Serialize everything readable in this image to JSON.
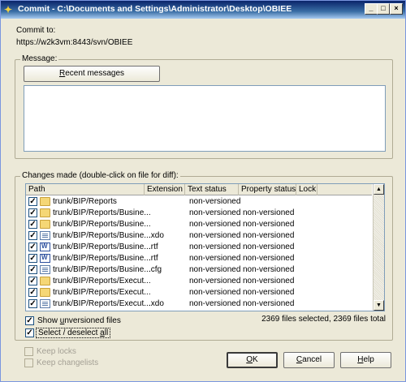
{
  "window": {
    "title": "Commit - C:\\Documents and Settings\\Administrator\\Desktop\\OBIEE",
    "minimize": "_",
    "maximize": "□",
    "close": "×"
  },
  "commit": {
    "label": "Commit to:",
    "url": "https://w2k3vm:8443/svn/OBIEE"
  },
  "message": {
    "group_label": "Message:",
    "recent_button": "Recent messages",
    "value": ""
  },
  "changes": {
    "group_label": "Changes made (double-click on file for diff):",
    "columns": [
      "Path",
      "Extension",
      "Text status",
      "Property status",
      "Lock"
    ],
    "rows": [
      {
        "checked": "✓",
        "icon": "folder",
        "path": "trunk/BIP/Reports",
        "ext": "",
        "text_status": "non-versioned",
        "prop_status": ""
      },
      {
        "checked": "✓",
        "icon": "folder",
        "path": "trunk/BIP/Reports/Busine...",
        "ext": "",
        "text_status": "non-versioned",
        "prop_status": "non-versioned"
      },
      {
        "checked": "✓",
        "icon": "folder",
        "path": "trunk/BIP/Reports/Busine...",
        "ext": "",
        "text_status": "non-versioned",
        "prop_status": "non-versioned"
      },
      {
        "checked": "✓",
        "icon": "doc",
        "path": "trunk/BIP/Reports/Busine...",
        "ext": ".xdo",
        "text_status": "non-versioned",
        "prop_status": "non-versioned"
      },
      {
        "checked": "✓",
        "icon": "word",
        "path": "trunk/BIP/Reports/Busine...",
        "ext": ".rtf",
        "text_status": "non-versioned",
        "prop_status": "non-versioned"
      },
      {
        "checked": "✓",
        "icon": "word",
        "path": "trunk/BIP/Reports/Busine...",
        "ext": ".rtf",
        "text_status": "non-versioned",
        "prop_status": "non-versioned"
      },
      {
        "checked": "✓",
        "icon": "doc",
        "path": "trunk/BIP/Reports/Busine...",
        "ext": ".cfg",
        "text_status": "non-versioned",
        "prop_status": "non-versioned"
      },
      {
        "checked": "✓",
        "icon": "folder",
        "path": "trunk/BIP/Reports/Execut...",
        "ext": "",
        "text_status": "non-versioned",
        "prop_status": "non-versioned"
      },
      {
        "checked": "✓",
        "icon": "folder",
        "path": "trunk/BIP/Reports/Execut...",
        "ext": "",
        "text_status": "non-versioned",
        "prop_status": "non-versioned"
      },
      {
        "checked": "✓",
        "icon": "doc",
        "path": "trunk/BIP/Reports/Execut...",
        "ext": ".xdo",
        "text_status": "non-versioned",
        "prop_status": "non-versioned"
      }
    ],
    "summary": "2369 files selected, 2369 files total"
  },
  "options": {
    "show_unversioned": {
      "checked": "✓",
      "label_pre": "Show ",
      "label_u": "u",
      "label_post": "nversioned files"
    },
    "select_all": {
      "checked": "✓",
      "label_pre": "Select / deselect ",
      "label_u": "a",
      "label_post": "ll"
    },
    "keep_locks": {
      "checked": "",
      "label": "Keep locks"
    },
    "keep_changelists": {
      "checked": "",
      "label": "Keep changelists"
    }
  },
  "buttons": {
    "ok": "OK",
    "cancel": "Cancel",
    "help": "Help"
  }
}
